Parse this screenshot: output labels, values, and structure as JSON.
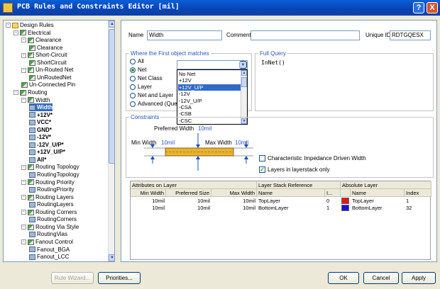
{
  "window": {
    "title": "PCB Rules and Constraints Editor [mil]",
    "help_glyph": "?",
    "close_glyph": "X"
  },
  "tree": {
    "items": [
      {
        "label": "Design Rules",
        "level": 0,
        "expander": "-",
        "icon": "folder-icon"
      },
      {
        "label": "Electrical",
        "level": 1,
        "expander": "-",
        "icon": "rule-group-icon"
      },
      {
        "label": "Clearance",
        "level": 2,
        "expander": "-",
        "icon": "rule-icon"
      },
      {
        "label": "Clearance",
        "level": 3,
        "expander": "",
        "icon": "rule-icon"
      },
      {
        "label": "Short-Circuit",
        "level": 2,
        "expander": "-",
        "icon": "rule-icon"
      },
      {
        "label": "ShortCircuit",
        "level": 3,
        "expander": "",
        "icon": "rule-icon"
      },
      {
        "label": "Un-Routed Net",
        "level": 2,
        "expander": "-",
        "icon": "rule-icon"
      },
      {
        "label": "UnRoutedNet",
        "level": 3,
        "expander": "",
        "icon": "rule-icon"
      },
      {
        "label": "Un-Connected Pin",
        "level": 2,
        "expander": "",
        "icon": "rule-icon"
      },
      {
        "label": "Routing",
        "level": 1,
        "expander": "-",
        "icon": "rule-group-icon"
      },
      {
        "label": "Width",
        "level": 2,
        "expander": "-",
        "icon": "rule-icon"
      },
      {
        "label": "Width",
        "level": 3,
        "expander": "",
        "icon": "net-icon",
        "selected": true
      },
      {
        "label": "+12V*",
        "level": 3,
        "expander": "",
        "icon": "net-icon",
        "bold": true
      },
      {
        "label": "VCC*",
        "level": 3,
        "expander": "",
        "icon": "net-icon",
        "bold": true
      },
      {
        "label": "GND*",
        "level": 3,
        "expander": "",
        "icon": "net-icon",
        "bold": true
      },
      {
        "label": "-12V*",
        "level": 3,
        "expander": "",
        "icon": "net-icon",
        "bold": true
      },
      {
        "label": "-12V_U/P*",
        "level": 3,
        "expander": "",
        "icon": "net-icon",
        "bold": true
      },
      {
        "label": "+12V_U/P*",
        "level": 3,
        "expander": "",
        "icon": "net-icon",
        "bold": true
      },
      {
        "label": "All*",
        "level": 3,
        "expander": "",
        "icon": "net-icon",
        "bold": true
      },
      {
        "label": "Routing Topology",
        "level": 2,
        "expander": "-",
        "icon": "rule-icon"
      },
      {
        "label": "RoutingTopology",
        "level": 3,
        "expander": "",
        "icon": "net-icon"
      },
      {
        "label": "Routing Priority",
        "level": 2,
        "expander": "-",
        "icon": "rule-icon"
      },
      {
        "label": "RoutingPriority",
        "level": 3,
        "expander": "",
        "icon": "net-icon"
      },
      {
        "label": "Routing Layers",
        "level": 2,
        "expander": "-",
        "icon": "rule-icon"
      },
      {
        "label": "RoutingLayers",
        "level": 3,
        "expander": "",
        "icon": "net-icon"
      },
      {
        "label": "Routing Corners",
        "level": 2,
        "expander": "-",
        "icon": "rule-icon"
      },
      {
        "label": "RoutingCorners",
        "level": 3,
        "expander": "",
        "icon": "net-icon"
      },
      {
        "label": "Routing Via Style",
        "level": 2,
        "expander": "-",
        "icon": "rule-icon"
      },
      {
        "label": "RoutingVias",
        "level": 3,
        "expander": "",
        "icon": "net-icon"
      },
      {
        "label": "Fanout Control",
        "level": 2,
        "expander": "-",
        "icon": "rule-icon"
      },
      {
        "label": "Fanout_BGA",
        "level": 3,
        "expander": "",
        "icon": "net-icon"
      },
      {
        "label": "Fanout_LCC",
        "level": 3,
        "expander": "",
        "icon": "net-icon"
      }
    ],
    "scroll_up": "▲",
    "scroll_down": "▼"
  },
  "rule": {
    "name_label": "Name",
    "name_value": "Width",
    "comment_label": "Comment",
    "comment_value": "",
    "uid_label": "Unique ID",
    "uid_value": "RDTGQESX"
  },
  "match": {
    "title": "Where the First object matches",
    "options": [
      "All",
      "Net",
      "Net Class",
      "Layer",
      "Net and Layer",
      "Advanced (Query)"
    ],
    "selected": "Net",
    "combo_value": "",
    "combo_arrow": "▼",
    "dropdown_items": [
      "No Net",
      "+12V",
      "+12V_U/P",
      "-12V",
      "-12V_U/P",
      "-CSA",
      "-CSB",
      "-CSC"
    ],
    "dropdown_selected": "+12V_U/P",
    "dd_up": "▲",
    "dd_down": "▼"
  },
  "full_query": {
    "title": "Full Query",
    "text": "InNet()"
  },
  "constraints": {
    "title": "Constraints",
    "preferred_label": "Preferred Width",
    "preferred_value": "10mil",
    "min_label": "Min Width",
    "min_value": "10mil",
    "max_label": "Max Width",
    "max_value": "10mil",
    "impedance_label": "Characteristic Impedance Driven Width",
    "impedance_checked": false,
    "layerstack_label": "Layers in layerstack only",
    "layerstack_checked": true,
    "check_glyph": "✓"
  },
  "table": {
    "group_headers": [
      "Attributes on Layer",
      "Layer Stack Reference",
      "Absolute Layer"
    ],
    "headers": [
      "Min Width",
      "Preferred Size",
      "Max Width",
      "Name",
      "I...",
      "",
      "Name",
      "Index"
    ],
    "rows": [
      {
        "min": "10mil",
        "pref": "10mil",
        "max": "10mil",
        "name": "TopLayer",
        "idx": "0",
        "color": "#e8141c",
        "abs_name": "TopLayer",
        "abs_idx": "1"
      },
      {
        "min": "10mil",
        "pref": "10mil",
        "max": "10mil",
        "name": "BottomLayer",
        "idx": "1",
        "color": "#1414d6",
        "abs_name": "BottomLayer",
        "abs_idx": "32"
      }
    ]
  },
  "footer": {
    "rule_wizard": "Rule Wizard...",
    "priorities": "Priorities...",
    "ok": "OK",
    "cancel": "Cancel",
    "apply": "Apply"
  }
}
